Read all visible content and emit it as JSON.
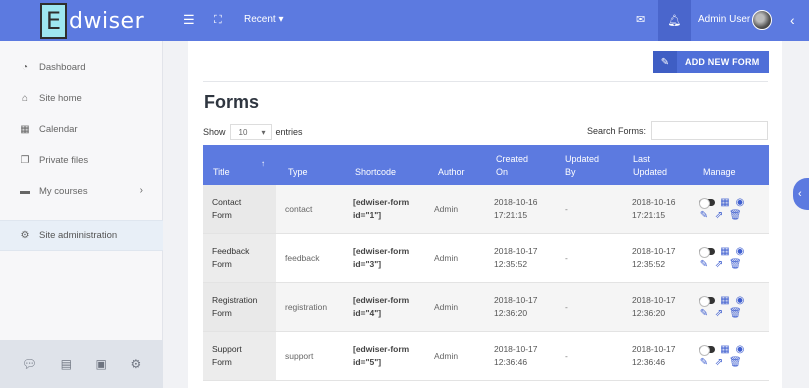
{
  "brand": {
    "logo_letter": "E",
    "logo_rest": "dwiser"
  },
  "topbar": {
    "menu_icon": "hamburger-icon",
    "fullscreen_icon": "expand-icon",
    "recent_label": "Recent ▾",
    "mail_icon": "envelope-icon",
    "bell_icon": "bell-icon",
    "user_name": "Admin User",
    "collapse_icon": "chevron-left-icon"
  },
  "sidebar": {
    "items": [
      {
        "label": "Dashboard",
        "icon": "tachometer-icon"
      },
      {
        "label": "Site home",
        "icon": "home-icon"
      },
      {
        "label": "Calendar",
        "icon": "calendar-icon"
      },
      {
        "label": "Private files",
        "icon": "files-icon"
      },
      {
        "label": "My courses",
        "icon": "archive-icon"
      },
      {
        "label": "Site administration",
        "icon": "cog-icon"
      }
    ],
    "bottom_icons": [
      "comments-icon",
      "file-icon",
      "archive-icon",
      "cogs-icon"
    ]
  },
  "main": {
    "add_button": "ADD NEW FORM",
    "title": "Forms",
    "show_label": "Show",
    "show_value": "10",
    "entries_label": "entries",
    "search_label": "Search Forms:",
    "search_value": ""
  },
  "table": {
    "headers": {
      "title": "Title",
      "type": "Type",
      "shortcode": "Shortcode",
      "author": "Author",
      "created_on_1": "Created",
      "created_on_2": "On",
      "updated_by_1": "Updated",
      "updated_by_2": "By",
      "last_updated_1": "Last",
      "last_updated_2": "Updated",
      "manage": "Manage"
    },
    "rows": [
      {
        "title1": "Contact",
        "title2": "Form",
        "type": "contact",
        "short1": "[edwiser-form",
        "short2": "id=\"1\"]",
        "author": "Admin",
        "created1": "2018-10-16",
        "created2": "17:21:15",
        "updated_by": "-",
        "last1": "2018-10-16",
        "last2": "17:21:15"
      },
      {
        "title1": "Feedback",
        "title2": "Form",
        "type": "feedback",
        "short1": "[edwiser-form",
        "short2": "id=\"3\"]",
        "author": "Admin",
        "created1": "2018-10-17",
        "created2": "12:35:52",
        "updated_by": "-",
        "last1": "2018-10-17",
        "last2": "12:35:52"
      },
      {
        "title1": "Registration",
        "title2": "Form",
        "type": "registration",
        "short1": "[edwiser-form",
        "short2": "id=\"4\"]",
        "author": "Admin",
        "created1": "2018-10-17",
        "created2": "12:36:20",
        "updated_by": "-",
        "last1": "2018-10-17",
        "last2": "12:36:20"
      },
      {
        "title1": "Support",
        "title2": "Form",
        "type": "support",
        "short1": "[edwiser-form",
        "short2": "id=\"5\"]",
        "author": "Admin",
        "created1": "2018-10-17",
        "created2": "12:36:46",
        "updated_by": "-",
        "last1": "2018-10-17",
        "last2": "12:36:46"
      }
    ]
  },
  "colors": {
    "primary": "#5c7ae0",
    "dark_primary": "#4a66cc",
    "button": "#4f6fd8",
    "icon_blue": "#3f5fd0"
  }
}
